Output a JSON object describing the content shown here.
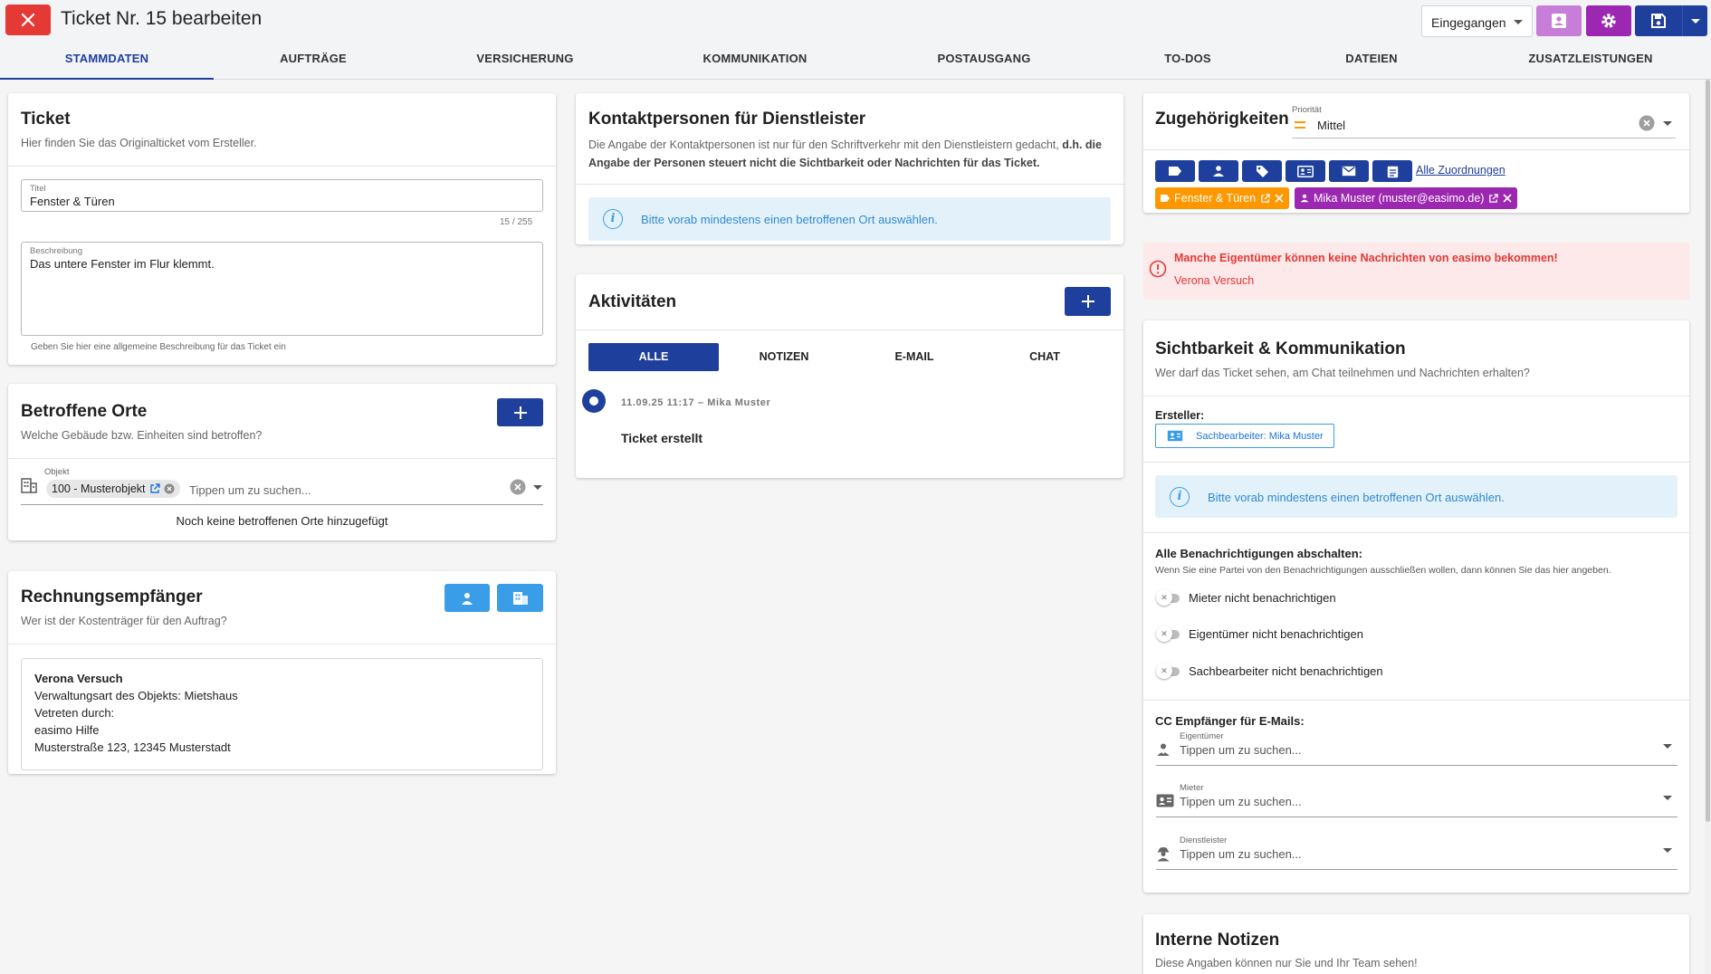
{
  "header": {
    "title": "Ticket Nr. 15 bearbeiten",
    "status": "Eingegangen"
  },
  "tabs": [
    "STAMMDATEN",
    "AUFTRÄGE",
    "VERSICHERUNG",
    "KOMMUNIKATION",
    "POSTAUSGANG",
    "TO-DOS",
    "DATEIEN",
    "ZUSATZLEISTUNGEN"
  ],
  "ticket": {
    "title": "Ticket",
    "subtitle": "Hier finden Sie das Originalticket vom Ersteller.",
    "titel_label": "Titel",
    "titel_value": "Fenster & Türen",
    "titel_counter": "15 / 255",
    "beschreibung_label": "Beschreibung",
    "beschreibung_value": "Das untere Fenster im Flur klemmt.",
    "beschreibung_hint": "Geben Sie hier eine allgemeine Beschreibung für das Ticket ein"
  },
  "orte": {
    "title": "Betroffene Orte",
    "subtitle": "Welche Gebäude bzw. Einheiten sind betroffen?",
    "objekt_label": "Objekt",
    "chip": "100 - Musterobjekt",
    "placeholder": "Tippen um zu suchen...",
    "empty": "Noch keine betroffenen Orte hinzugefügt"
  },
  "rechnung": {
    "title": "Rechnungsempfänger",
    "subtitle": "Wer ist der Kostenträger für den Auftrag?",
    "name": "Verona Versuch",
    "line1": "Verwaltungsart des Objekts: Mietshaus",
    "line2": "Vetreten durch:",
    "line3": "easimo Hilfe",
    "line4": "Musterstraße 123, 12345 Musterstadt"
  },
  "kontakt": {
    "title": "Kontaktpersonen für Dienstleister",
    "text_normal": "Die Angabe der Kontaktpersonen ist nur für den Schriftverkehr mit den Dienstleistern gedacht,",
    "text_bold": "d.h. die Angabe der Personen steuert nicht die Sichtbarkeit oder Nachrichten für das Ticket.",
    "info": "Bitte vorab mindestens einen betroffenen Ort auswählen."
  },
  "aktivitaeten": {
    "title": "Aktivitäten",
    "filters": [
      "ALLE",
      "NOTIZEN",
      "E-MAIL",
      "CHAT"
    ],
    "entry_meta": "11.09.25 11:17 – Mika Muster",
    "entry_text": "Ticket erstellt"
  },
  "zugehoerigkeiten": {
    "title": "Zugehörigkeiten",
    "prio_label": "Priorität",
    "prio_value": "Mittel",
    "alle_link": "Alle Zuordnungen",
    "tag1": "Fenster & Türen",
    "tag2": "Mika Muster (muster@easimo.de)"
  },
  "warning": {
    "title": "Manche Eigentümer können keine Nachrichten von easimo bekommen!",
    "name": "Verona Versuch"
  },
  "sichtbarkeit": {
    "title": "Sichtbarkeit & Kommunikation",
    "subtitle": "Wer darf das Ticket sehen, am Chat teilnehmen und Nachrichten erhalten?",
    "ersteller_label": "Ersteller:",
    "ersteller_chip": "Sachbearbeiter: Mika Muster",
    "info": "Bitte vorab mindestens einen betroffenen Ort auswählen.",
    "notif_title": "Alle Benachrichtigungen abschalten:",
    "notif_sub": "Wenn Sie eine Partei von den Benachrichtigungen ausschließen wollen, dann können Sie das hier angeben.",
    "toggles": [
      "Mieter nicht benachrichtigen",
      "Eigentümer nicht benachrichtigen",
      "Sachbearbeiter nicht benachrichtigen"
    ],
    "cc_title": "CC Empfänger für E-Mails:",
    "cc": [
      {
        "label": "Eigentümer",
        "placeholder": "Tippen um zu suchen..."
      },
      {
        "label": "Mieter",
        "placeholder": "Tippen um zu suchen..."
      },
      {
        "label": "Dienstleister",
        "placeholder": "Tippen um zu suchen..."
      }
    ]
  },
  "notizen": {
    "title": "Interne Notizen",
    "subtitle": "Diese Angaben können nur Sie und Ihr Team sehen!"
  },
  "colors": {
    "primary": "#1e3f9c",
    "danger": "#e53935",
    "purple": "#9c27b0",
    "light_blue": "#3a9de8",
    "orange": "#ff9800"
  }
}
